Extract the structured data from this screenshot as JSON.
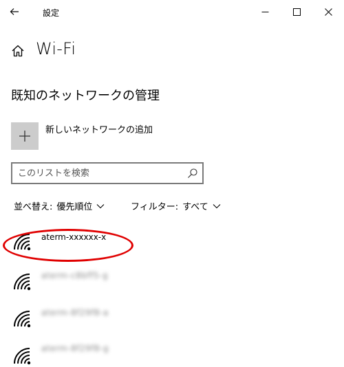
{
  "window": {
    "title": "設定",
    "back_icon": "arrow-left-icon",
    "controls": {
      "minimize_icon": "minimize-icon",
      "maximize_icon": "maximize-icon",
      "close_icon": "close-icon"
    }
  },
  "header": {
    "home_icon": "home-icon",
    "title": "Wi-Fi"
  },
  "section": {
    "title": "既知のネットワークの管理"
  },
  "add_network": {
    "icon": "plus-icon",
    "label": "新しいネットワークの追加"
  },
  "search": {
    "placeholder": "このリストを検索",
    "value": "",
    "icon": "search-icon"
  },
  "sort": {
    "label": "並べ替え:",
    "value": "優先順位"
  },
  "filter": {
    "label": "フィルター:",
    "value": "すべて"
  },
  "networks": [
    {
      "name": "aterm-xxxxxx-x",
      "icon": "wifi-icon",
      "highlighted": true
    },
    {
      "name": "aterm-c8bff5-g",
      "icon": "wifi-icon",
      "blurred": true
    },
    {
      "name": "aterm-8f29f8-a",
      "icon": "wifi-icon",
      "blurred": true
    },
    {
      "name": "aterm-8f29f8-g",
      "icon": "wifi-icon",
      "blurred": true
    }
  ],
  "colors": {
    "accent_highlight": "#e00000",
    "add_button_bg": "#cccccc",
    "search_border": "#7a7a7a"
  }
}
